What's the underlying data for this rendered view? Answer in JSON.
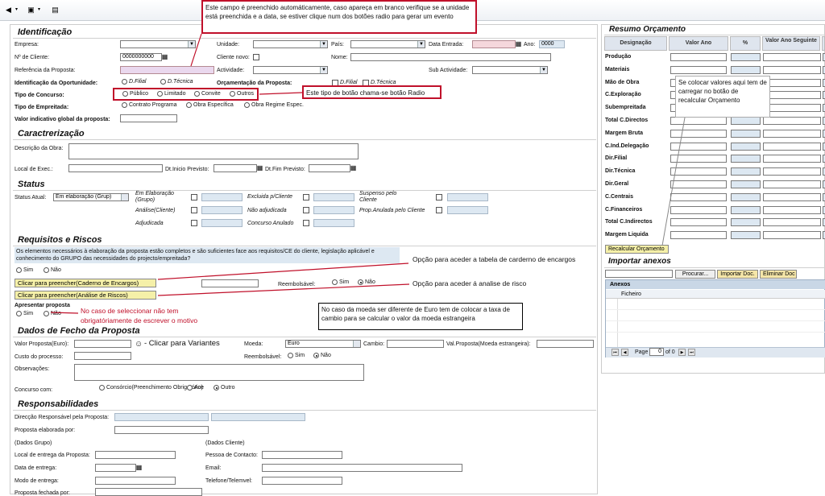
{
  "toolbar": {
    "icons": [
      "back-icon",
      "save-icon",
      "print-icon"
    ]
  },
  "annotations": {
    "auto_field": "Este campo é preenchido automáticamente, caso apareça em branco verifique se a unidade está preenchida e a data, se estiver clique num dos botões radio para gerar um evento",
    "radio_type": "Este tipo de botão chama-se botão Radio",
    "recalc": "Se colocar valores aqui tem de carregar no botão de recalcular Orçamento",
    "caderno": "Opção para aceder a tabela de carderno de encargos",
    "risco": "Opção para aceder á analise de risco",
    "motivo": "No caso de seleccionar não tem obrigatóriamente de escrever o motivo",
    "moeda": "No caso da moeda ser diferente de Euro tem de colocar a taxa de cambio para se calcular o valor da moeda estrangeira",
    "variantes": "- Clicar para Variantes"
  },
  "identificacao": {
    "title": "Identificação",
    "empresa": "Empresa:",
    "unidade": "Unidade:",
    "pais": "País:",
    "data_entrada": "Data Entrada:",
    "ano": "Ano:",
    "ano_value": "0000",
    "n_cliente": "Nº de Cliente:",
    "n_cliente_value": "0000000000",
    "cliente_novo": "Cliente novo:",
    "nome": "Nome:",
    "referencia": "Referência da Proposta:",
    "actividade": "Actividade:",
    "sub_actividade": "Sub Actividade:",
    "ident_oportunidade": "Identificação da Oportunidade:",
    "d_filial": "D.Filial",
    "d_tecnica": "D.Técnica",
    "orcamentacao": "Orçamentação da Proposta:",
    "o_filial": "D.Filial",
    "o_tecnica": "D.Técnica",
    "tipo_concurso": "Tipo de Concurso:",
    "publico": "Público",
    "limitado": "Limitado",
    "convite": "Convite",
    "outros": "Outros",
    "tipo_empreitada": "Tipo de Empreitada:",
    "contrato": "Contrato Programa",
    "obra_especifica": "Obra Específica",
    "obra_regime": "Obra Regime Espec.",
    "valor_indicativo": "Valor indicativo global da proposta:"
  },
  "caracterizacao": {
    "title": "Caractrerização",
    "descricao": "Descrição da Obra:",
    "local": "Local de Exec.:",
    "dt_inicio": "Dt.Inicio Previsto:",
    "dt_fim": "Dt.Fim Previsto:"
  },
  "status": {
    "title": "Status",
    "status_atual": "Status Atual:",
    "status_value": "Em elaboração (Grup)",
    "em_elaboracao": "Em Elaboração (Grupo)",
    "analise": "Análise(Cliente)",
    "adjudicada": "Adjudicada",
    "excluida": "Excluida p/Cliente",
    "nao_adjudicada": "Não adjudicada",
    "concurso_anulado": "Concurso Anulado",
    "suspenso": "Suspenso pelo Cliente",
    "prop_anulada": "Prop.Anulada pelo Cliente"
  },
  "requisitos": {
    "title": "Requisitos e Riscos",
    "text": "Os elementos necessários à elaboração da proposta estão completos e são suficientes face aos requisitos/CE do cliente, legislação aplicável e conhecimento do GRUPO das necessidades do projecto/empreitada?",
    "sim": "Sim",
    "nao": "Não",
    "caderno_btn": "Clicar para preencher(Caderno de Encargos)",
    "analise_btn": "Clicar para preencher(Análise de Riscos)",
    "reembolsavel": "Reembolsável:",
    "r_sim": "Sim",
    "r_nao": "Não",
    "apresentar": "Apresentar proposta",
    "a_sim": "Sim",
    "a_nao": "Não"
  },
  "fecho": {
    "title": "Dados de Fecho da Proposta",
    "valor_euro": "Valor Proposta(Euro):",
    "moeda": "Moeda:",
    "moeda_value": "Euro",
    "cambio": "Cambio:",
    "val_moeda": "Val.Proposta(Moeda estrangeira):",
    "custo": "Custo do processo:",
    "reembolsavel": "Reembolsável:",
    "sim": "Sim",
    "nao": "Não",
    "observacoes": "Observações:",
    "concurso_com": "Concurso com:",
    "consorcio": "Consórcio(Preenchimento Obrigatório)",
    "ace": "Ace",
    "outro": "Outro"
  },
  "responsabilidades": {
    "title": "Responsabilidades",
    "direccao": "Direcção Responsável pela Proposta:",
    "elaborada": "Proposta elaborada por:",
    "dados_grupo": "(Dados Grupo)",
    "dados_cliente": "(Dados Cliente)",
    "local_entrega": "Local de entrega da Proposta:",
    "pessoa": "Pessoa de Contacto:",
    "data_entrega": "Data de entrega:",
    "email": "Email:",
    "modo_entrega": "Modo de entrega:",
    "telefone": "Telefone/Telemvel:",
    "fechada": "Proposta fechada por:"
  },
  "resumo": {
    "title": "Resumo Orçamento",
    "headers": [
      "Designação",
      "Valor Ano",
      "%",
      "Valor Ano Seguinte"
    ],
    "rows": [
      "Produção",
      "Materiais",
      "Mão de Obra",
      "C.Exploração",
      "Subempreitada",
      "Total C.Directos",
      "Margem Bruta",
      "C.Ind.Delegação",
      "Dir.Filial",
      "Dir.Técnica",
      "Dir.Geral",
      "C.Centrais",
      "C.Financeiros",
      "Total C.Indirectos",
      "Margem Liquida"
    ],
    "recalc_btn": "Recalcular Orçamento"
  },
  "anexos": {
    "title": "Importar anexos",
    "procurar": "Procurar...",
    "importar": "Importar Doc.",
    "eliminar": "Eliminar Doc",
    "grid_title": "Anexos",
    "col_ficheiro": "Ficheiro",
    "page": "Page",
    "page_value": "0",
    "of": "of 0"
  }
}
